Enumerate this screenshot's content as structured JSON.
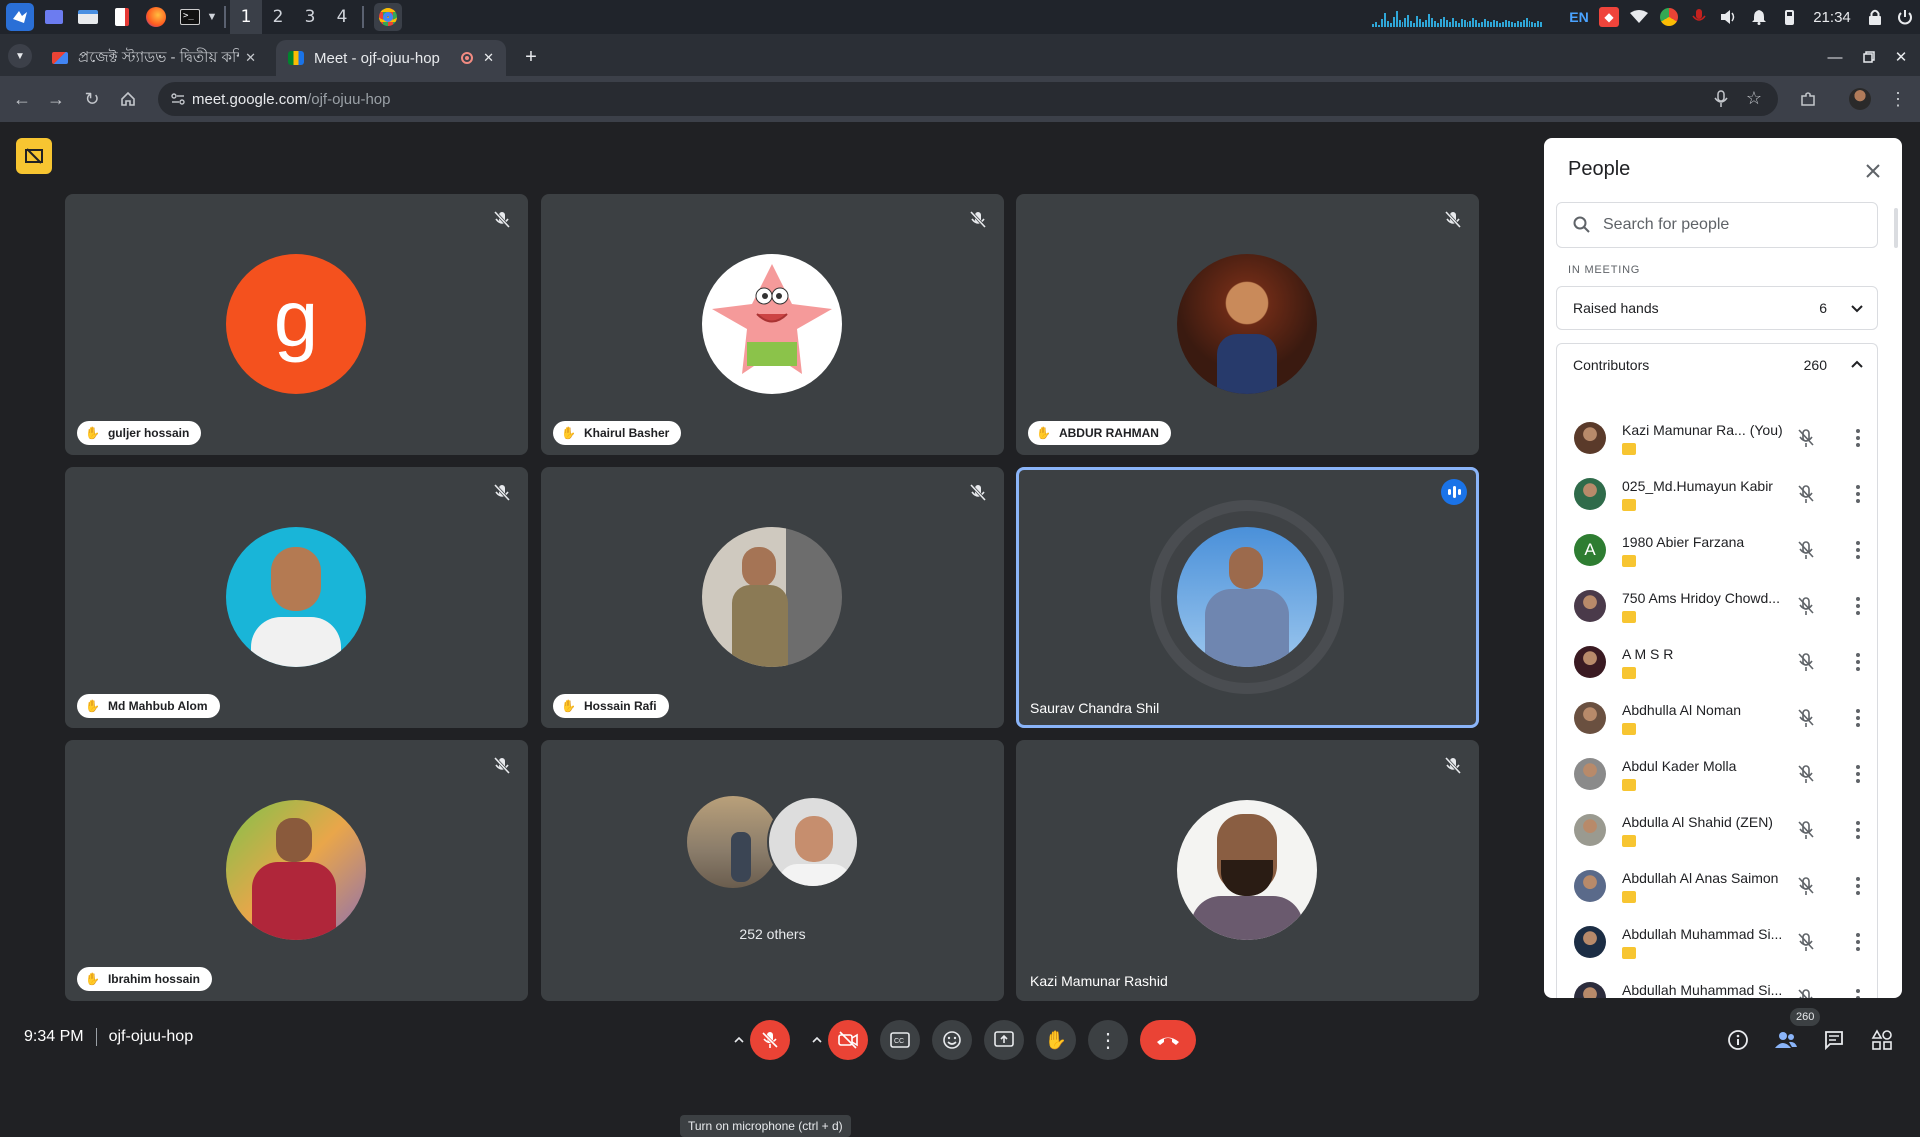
{
  "taskbar": {
    "workspaces": [
      "1",
      "2",
      "3",
      "4"
    ],
    "active_workspace": "1",
    "language": "EN",
    "clock": "21:34"
  },
  "browser": {
    "tabs": [
      {
        "title": "প্রজেক্ট স্ট্যাডভ - দ্বিতীয় কম্পিউটার ল",
        "icon": "gmail-icon",
        "active": false
      },
      {
        "title": "Meet - ojf-ojuu-hop",
        "icon": "meet-icon",
        "active": true
      }
    ],
    "url_host": "meet.google.com",
    "url_path": "/ojf-ojuu-hop"
  },
  "tiles": [
    {
      "name": "guljer hossain",
      "avatar": "letter",
      "letter": "g",
      "color": "#f4511e",
      "hand": true,
      "muted": true
    },
    {
      "name": "Khairul Basher",
      "avatar": "patrick",
      "hand": true,
      "muted": true
    },
    {
      "name": "ABDUR RAHMAN",
      "avatar": "photo",
      "hand": true,
      "muted": true
    },
    {
      "name": "Md Mahbub Alom",
      "avatar": "photo",
      "hand": true,
      "muted": true
    },
    {
      "name": "Hossain Rafi",
      "avatar": "photo",
      "hand": true,
      "muted": true
    },
    {
      "name": "Saurav Chandra Shil",
      "avatar": "photo",
      "hand": false,
      "muted": false,
      "speaking": true
    },
    {
      "name": "Ibrahim hossain",
      "avatar": "photo",
      "hand": true,
      "muted": true
    },
    {
      "name": "252 others",
      "avatar": "group",
      "hand": false,
      "muted": false
    },
    {
      "name": "Kazi Mamunar Rashid",
      "avatar": "photo",
      "hand": false,
      "muted": true
    }
  ],
  "people_panel": {
    "title": "People",
    "search_placeholder": "Search for people",
    "section_label": "IN MEETING",
    "raised_hands": {
      "label": "Raised hands",
      "count": "6"
    },
    "contributors": {
      "label": "Contributors",
      "count": "260"
    },
    "you_label": "(You)",
    "list": [
      {
        "name": "Kazi Mamunar Ra...",
        "you": true
      },
      {
        "name": "025_Md.Humayun Kabir",
        "you": false
      },
      {
        "name": "1980 Abier Farzana",
        "you": false,
        "letter": "A"
      },
      {
        "name": "750 Ams Hridoy Chowd...",
        "you": false
      },
      {
        "name": "A M S R",
        "you": false
      },
      {
        "name": "Abdhulla Al Noman",
        "you": false
      },
      {
        "name": "Abdul Kader Molla",
        "you": false
      },
      {
        "name": "Abdulla Al Shahid (ZEN)",
        "you": false
      },
      {
        "name": "Abdullah Al Anas Saimon",
        "you": false
      },
      {
        "name": "Abdullah Muhammad Si...",
        "you": false
      },
      {
        "name": "Abdullah Muhammad Si...",
        "you": false
      }
    ]
  },
  "bottom_bar": {
    "time": "9:34 PM",
    "meeting_code": "ojf-ojuu-hop",
    "tooltip": "Turn on microphone (ctrl + d)",
    "people_badge": "260"
  },
  "colors": {
    "accent": "#1a73e8",
    "danger": "#ea4335",
    "background": "#202124",
    "tile": "#3c4043",
    "badge": "#f7c531"
  }
}
